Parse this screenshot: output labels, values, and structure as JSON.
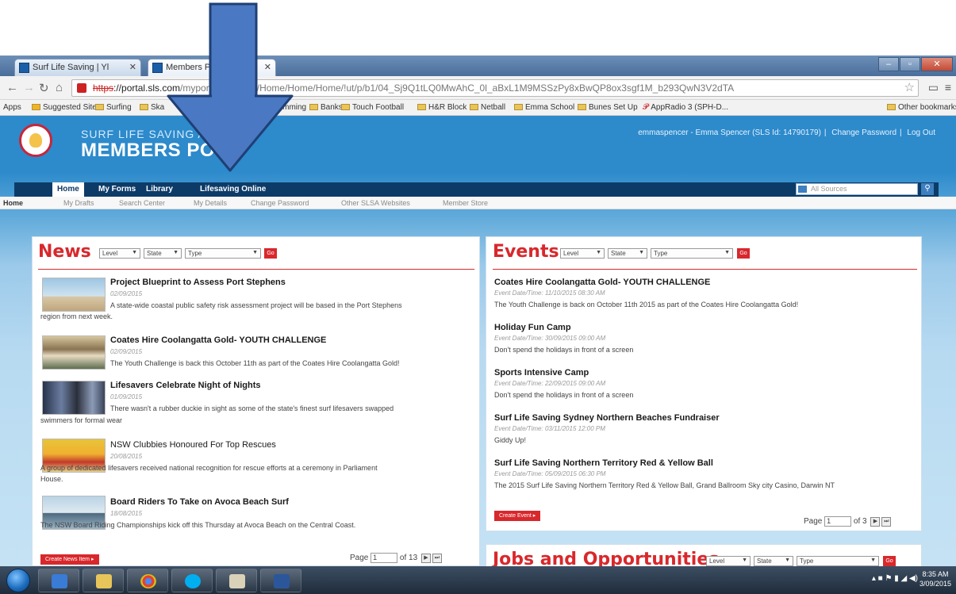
{
  "browser": {
    "tabs": [
      {
        "label": "Surf Life Saving | Yl"
      },
      {
        "label": "Members Po"
      }
    ],
    "url_scheme": "https",
    "url_host": "://portal.sls.com",
    "url_path": "myportal/member/Home/Home/Home/!ut/p/b1/04_Sj9Q1tLQ0MwAhC_0l_aBxL1M9MSSzPy8xBwQP8ox3sgf1M_b293QwN3V2dTA",
    "bookmarks": [
      {
        "label": "Apps"
      },
      {
        "label": "Suggested Sites"
      },
      {
        "label": "Surfing"
      },
      {
        "label": "Ska"
      },
      {
        "label": "DC"
      },
      {
        "label": "Swimming"
      },
      {
        "label": "Banks"
      },
      {
        "label": "Touch Football"
      },
      {
        "label": "H&R Block"
      },
      {
        "label": "Netball"
      },
      {
        "label": "Emma School"
      },
      {
        "label": "Bunes Set Up"
      },
      {
        "label": "AppRadio 3 (SPH-D..."
      },
      {
        "label": "Other bookmarks"
      }
    ]
  },
  "portal": {
    "brand_top": "SURF LIFE SAVING A",
    "brand_main": "MEMBERS PO",
    "user_info": "emmaspencer - Emma Spencer (SLS Id: 14790179)",
    "change_password_link": "Change Password",
    "logout_link": "Log Out",
    "nav": [
      {
        "label": "Home"
      },
      {
        "label": "My Forms"
      },
      {
        "label": "Library"
      },
      {
        "label": "Lifesaving Online"
      }
    ],
    "search_placeholder": "All Sources",
    "subnav": [
      {
        "label": "Home"
      },
      {
        "label": "My Drafts"
      },
      {
        "label": "Search Center"
      },
      {
        "label": "My Details"
      },
      {
        "label": "Change Password"
      },
      {
        "label": "Other SLSA Websites"
      },
      {
        "label": "Member Store"
      }
    ]
  },
  "news": {
    "title": "News",
    "filters": {
      "level": "Level",
      "state": "State",
      "type": "Type",
      "go": "Go"
    },
    "items": [
      {
        "title": "Project Blueprint to Assess Port Stephens",
        "date": "02/09/2015",
        "text": "A state-wide coastal public safety risk assessment project will be based in the Port Stephens",
        "text2": "region from next week."
      },
      {
        "title": "Coates Hire Coolangatta Gold- YOUTH CHALLENGE",
        "date": "02/09/2015",
        "text": "The Youth Challenge is back this October 11th as part of the Coates Hire Coolangatta Gold!",
        "text2": ""
      },
      {
        "title": "Lifesavers Celebrate Night of Nights",
        "date": "01/09/2015",
        "text": "There wasn't a rubber duckie in sight as some of the state's finest surf lifesavers swapped",
        "text2": "swimmers for formal wear"
      },
      {
        "title": "NSW Clubbies Honoured For Top Rescues",
        "date": "20/08/2015",
        "text": "A group of dedicated lifesavers received national recognition for rescue efforts at a ceremony in Parliament",
        "text2": "House."
      },
      {
        "title": "Board Riders To Take on Avoca Beach Surf",
        "date": "18/08/2015",
        "text": "The NSW Board Riding Championships kick off this Thursday at Avoca Beach on the Central Coast.",
        "text2": ""
      }
    ],
    "create_button": "Create News Item",
    "page_label": "Page",
    "page_value": "1",
    "page_of": "of 13"
  },
  "events": {
    "title": "Events",
    "filters": {
      "level": "Level",
      "state": "State",
      "type": "Type",
      "go": "Go"
    },
    "items": [
      {
        "title": "Coates Hire Coolangatta Gold- YOUTH CHALLENGE",
        "date": "Event Date/Time: 11/10/2015 08:30 AM",
        "text": "The Youth Challenge is back on October 11th 2015 as part of the Coates Hire Coolangatta Gold!"
      },
      {
        "title": "Holiday Fun Camp",
        "date": "Event Date/Time: 30/09/2015 09:00 AM",
        "text": "Don't spend the holidays in front of a screen"
      },
      {
        "title": "Sports Intensive Camp",
        "date": "Event Date/Time: 22/09/2015 09:00 AM",
        "text": "Don't spend the holidays in front of a screen"
      },
      {
        "title": "Surf Life Saving Sydney Northern Beaches Fundraiser",
        "date": "Event Date/Time: 03/11/2015 12:00 PM",
        "text": "Giddy Up!"
      },
      {
        "title": "Surf Life Saving Northern Territory Red & Yellow Ball",
        "date": "Event Date/Time: 05/09/2015 06:30 PM",
        "text": "The 2015 Surf Life Saving Northern Territory Red & Yellow Ball, Grand Ballroom Sky city Casino, Darwin NT"
      }
    ],
    "create_button": "Create Event",
    "page_label": "Page",
    "page_value": "1",
    "page_of": "of 3"
  },
  "jobs": {
    "title": "Jobs and Opportunities",
    "filters": {
      "level": "Level",
      "state": "State",
      "type": "Type",
      "go": "Go"
    }
  },
  "taskbar": {
    "time": "8:35 AM",
    "date": "3/09/2015"
  },
  "colors": {
    "portal_blue": "#2d8acb",
    "nav_dark": "#0d3b68",
    "accent_red": "#d8282c",
    "annotation_arrow": "#4a78c2"
  }
}
